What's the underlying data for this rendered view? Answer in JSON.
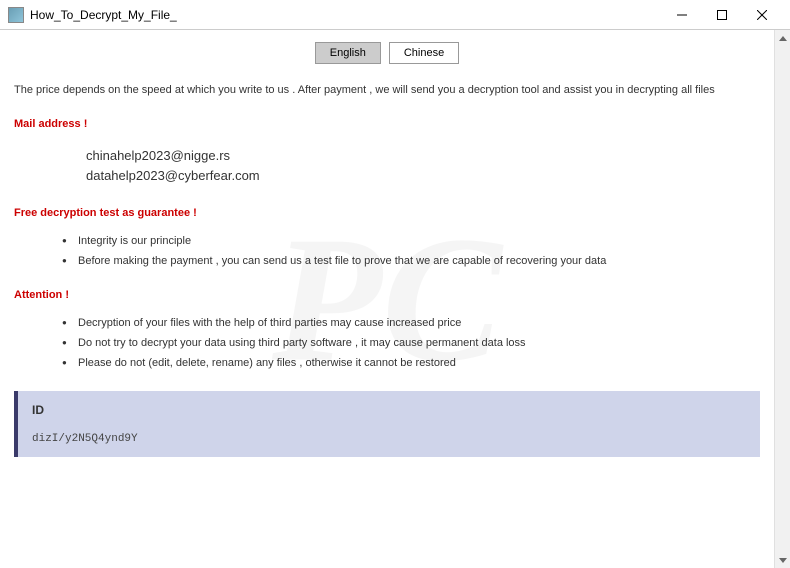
{
  "window": {
    "title": "How_To_Decrypt_My_File_"
  },
  "lang": {
    "english": "English",
    "chinese": "Chinese"
  },
  "intro": "The price depends on the speed at which you write to us . After payment , we will send you a decryption tool and assist you in decrypting all files",
  "sections": {
    "mail": {
      "header": "Mail address !",
      "email1": "chinahelp2023@nigge.rs",
      "email2": "datahelp2023@cyberfear.com"
    },
    "guarantee": {
      "header": "Free decryption test as guarantee !",
      "items": [
        "Integrity is our principle",
        "Before making the payment , you can send us a test file to prove that we are capable of recovering your data"
      ]
    },
    "attention": {
      "header": "Attention !",
      "items": [
        "Decryption of your files with the help of third parties may cause increased price",
        "Do not try to decrypt your data using third party software , it may cause permanent data loss",
        "Please do not (edit, delete, rename) any files , otherwise it cannot be restored"
      ]
    },
    "id": {
      "label": "ID",
      "value": "dizI/y2N5Q4ynd9Y"
    }
  },
  "watermark": {
    "main": "PC",
    "sub": "risk.com"
  }
}
